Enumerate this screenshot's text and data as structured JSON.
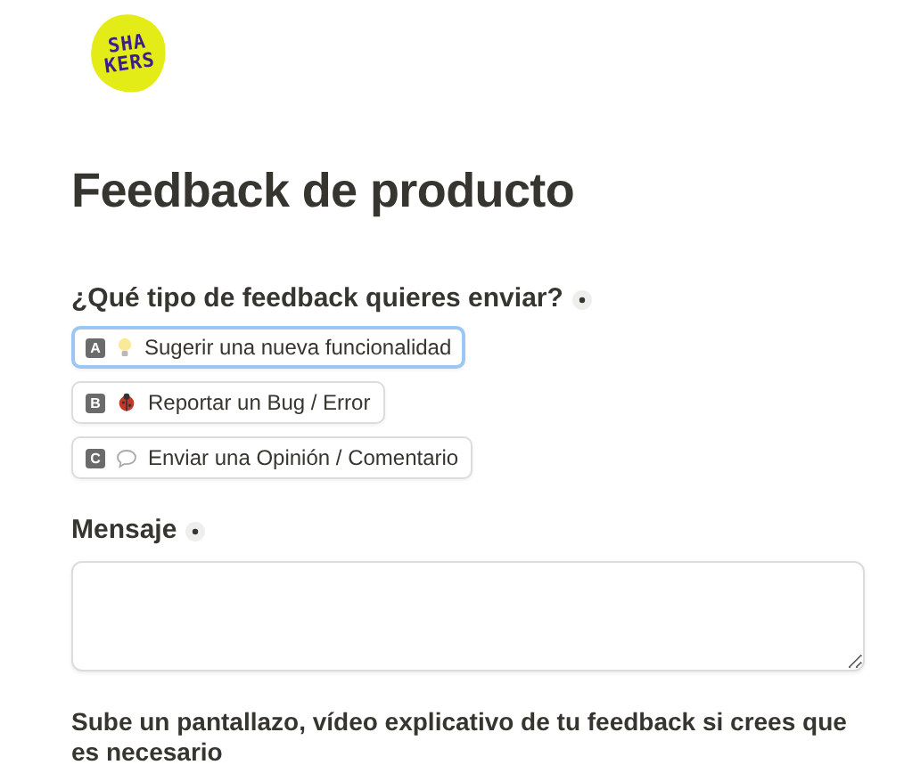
{
  "logo": {
    "lines": [
      "SHA",
      "KERS"
    ]
  },
  "title": "Feedback de producto",
  "question": {
    "label": "¿Qué tipo de feedback quieres enviar?",
    "required": true,
    "options": [
      {
        "key": "A",
        "kind": "bulb",
        "label": "Sugerir una nueva funcionalidad",
        "selected": true
      },
      {
        "key": "B",
        "kind": "bug",
        "label": "Reportar un Bug / Error",
        "selected": false
      },
      {
        "key": "C",
        "kind": "speech",
        "label": "Enviar una Opinión / Comentario",
        "selected": false
      }
    ]
  },
  "message": {
    "label": "Mensaje",
    "required": true
  },
  "upload": {
    "label": "Sube un pantallazo, vídeo explicativo de tu feedback si crees que es necesario"
  }
}
